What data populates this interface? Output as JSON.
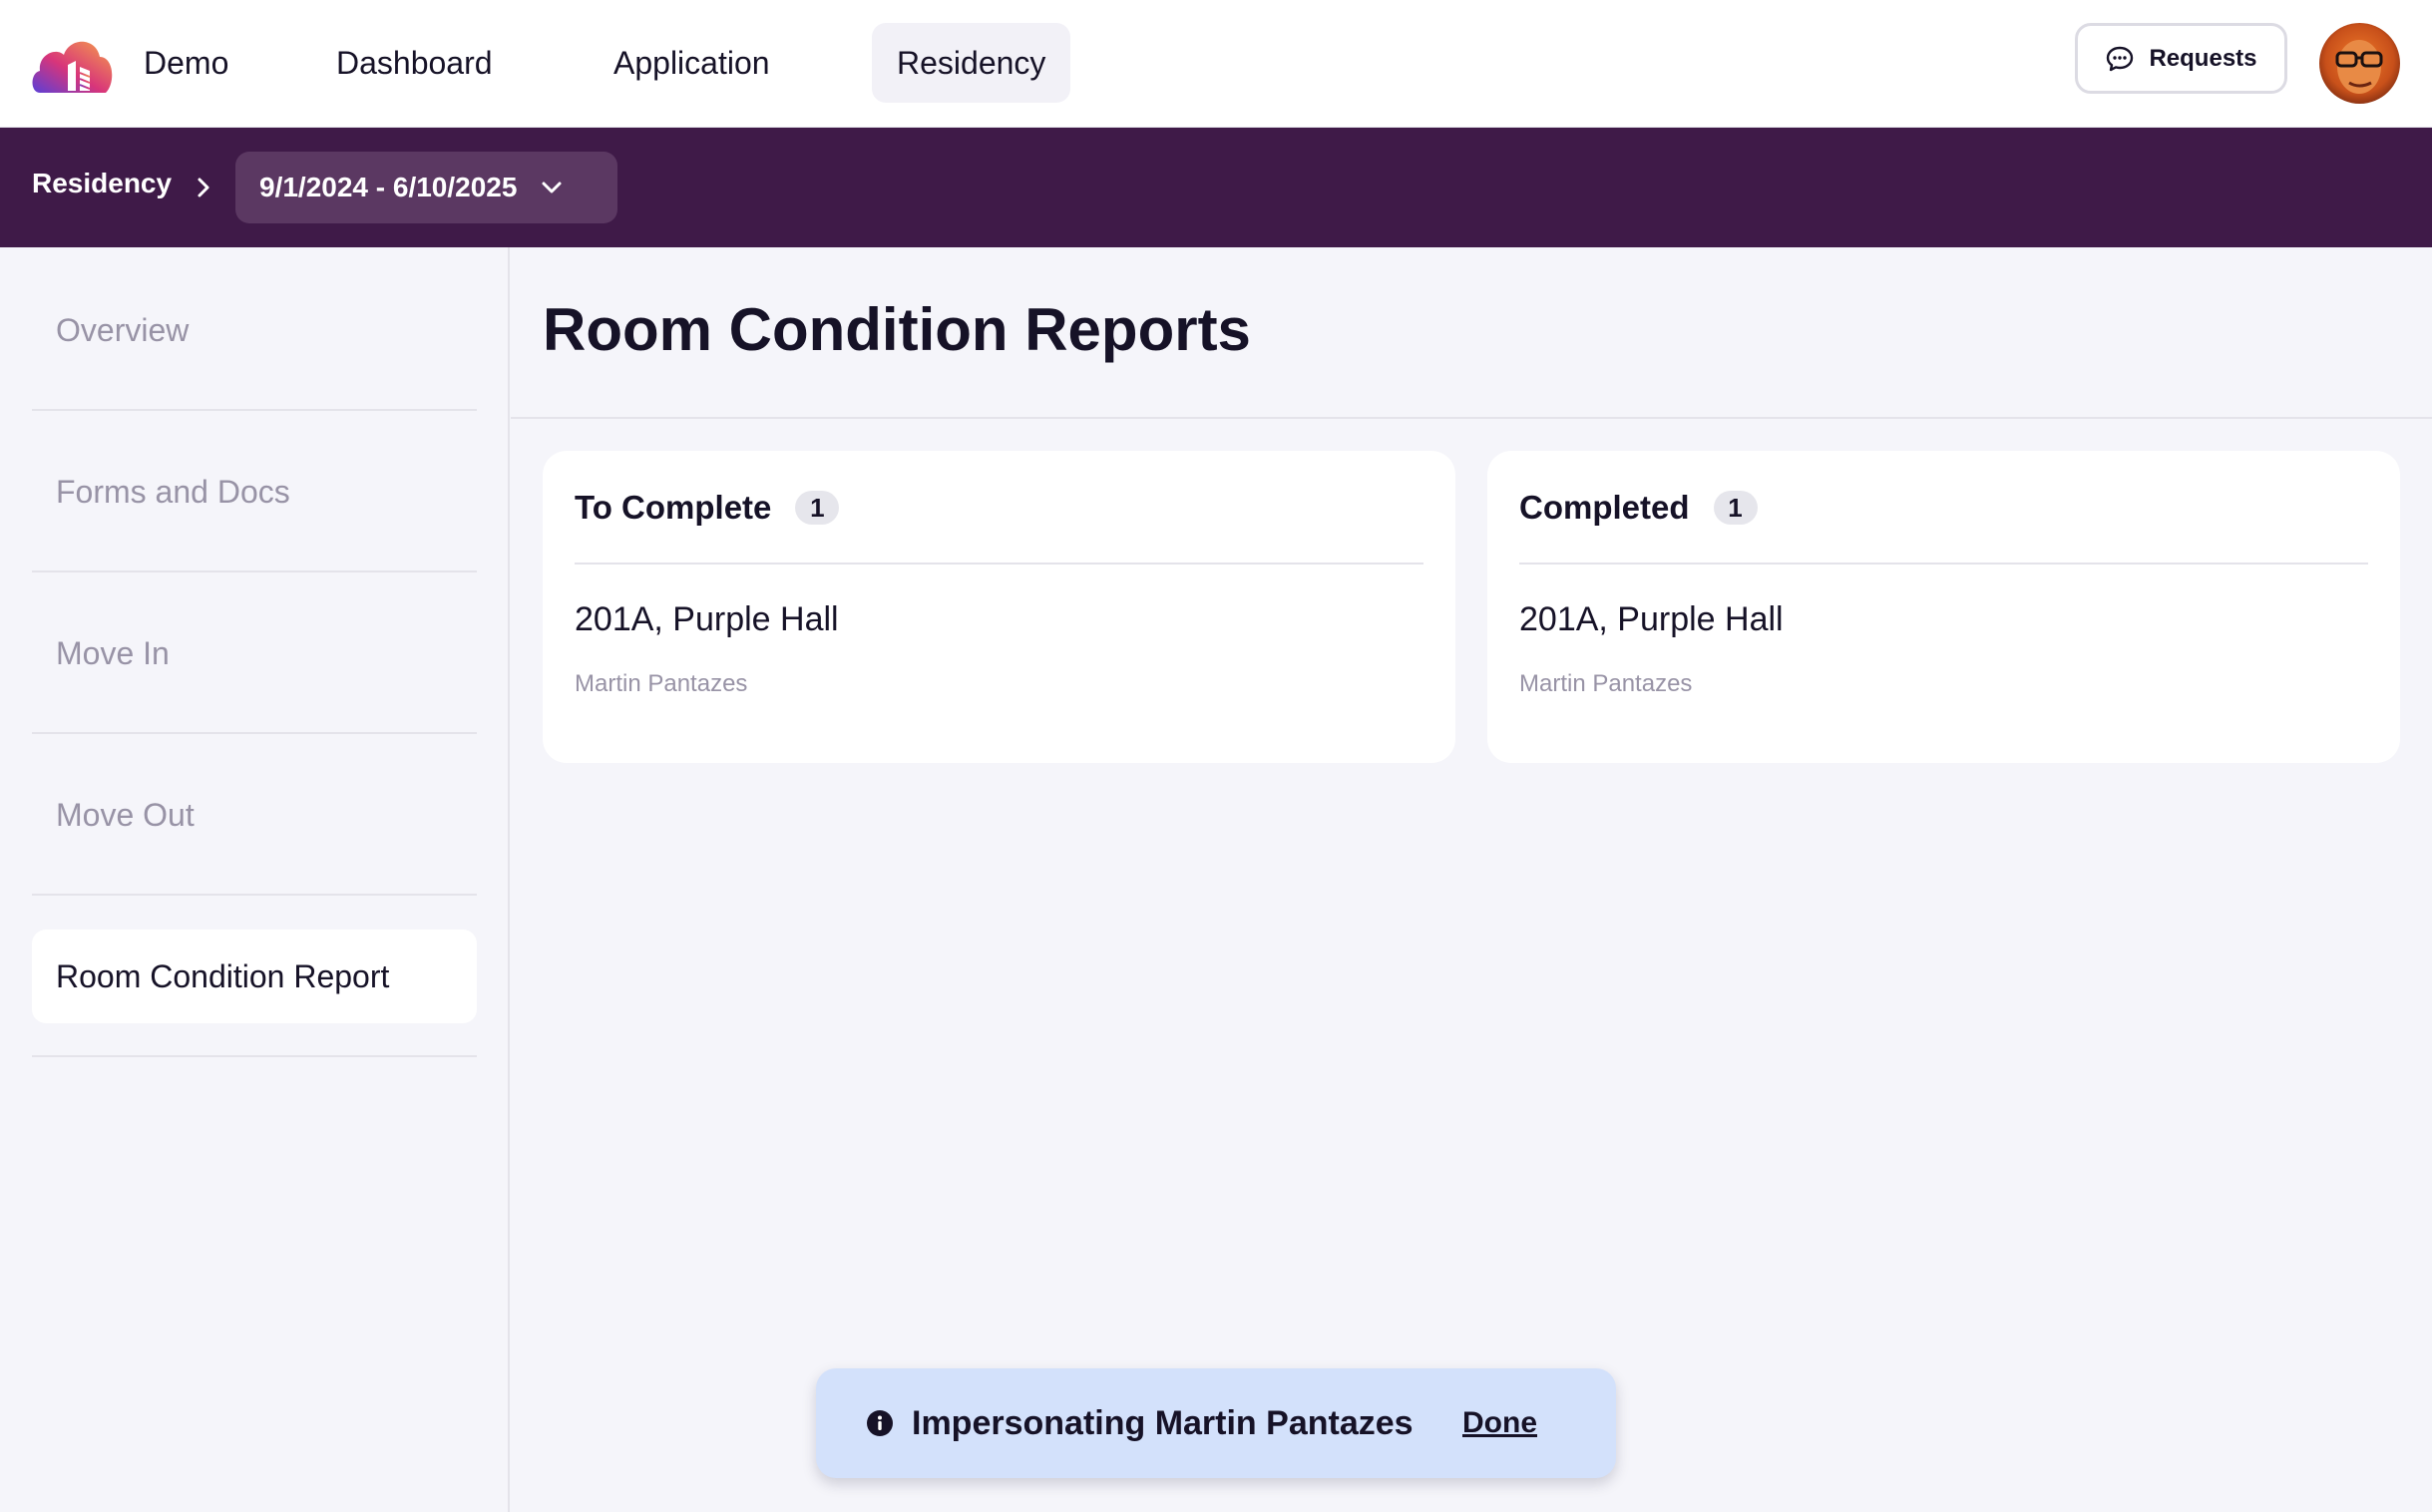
{
  "topnav": {
    "app_name": "Demo",
    "items": [
      {
        "label": "Dashboard",
        "active": false
      },
      {
        "label": "Application",
        "active": false
      },
      {
        "label": "Residency",
        "active": true
      }
    ],
    "requests_label": "Requests",
    "logo_icon": "cloud-building-logo",
    "requests_icon": "chat-bubble-icon",
    "avatar_icon": "user-avatar"
  },
  "breadcrumb": {
    "root": "Residency",
    "separator_icon": "chevron-right-icon",
    "term": "9/1/2024 - 6/10/2025",
    "term_icon": "chevron-down-icon"
  },
  "sidebar": {
    "items": [
      {
        "label": "Overview",
        "active": false
      },
      {
        "label": "Forms and Docs",
        "active": false
      },
      {
        "label": "Move In",
        "active": false
      },
      {
        "label": "Move Out",
        "active": false
      },
      {
        "label": "Room Condition Report",
        "active": true
      }
    ]
  },
  "main": {
    "title": "Room Condition Reports",
    "cards": [
      {
        "heading": "To Complete",
        "count": "1",
        "room": "201A, Purple Hall",
        "person": "Martin Pantazes"
      },
      {
        "heading": "Completed",
        "count": "1",
        "room": "201A, Purple Hall",
        "person": "Martin Pantazes"
      }
    ]
  },
  "toast": {
    "message": "Impersonating Martin Pantazes",
    "action": "Done",
    "icon": "info-icon"
  },
  "colors": {
    "brand_bar": "#3f1a48",
    "toast_bg": "#d3e1fb",
    "page_bg": "#f5f5fa"
  }
}
